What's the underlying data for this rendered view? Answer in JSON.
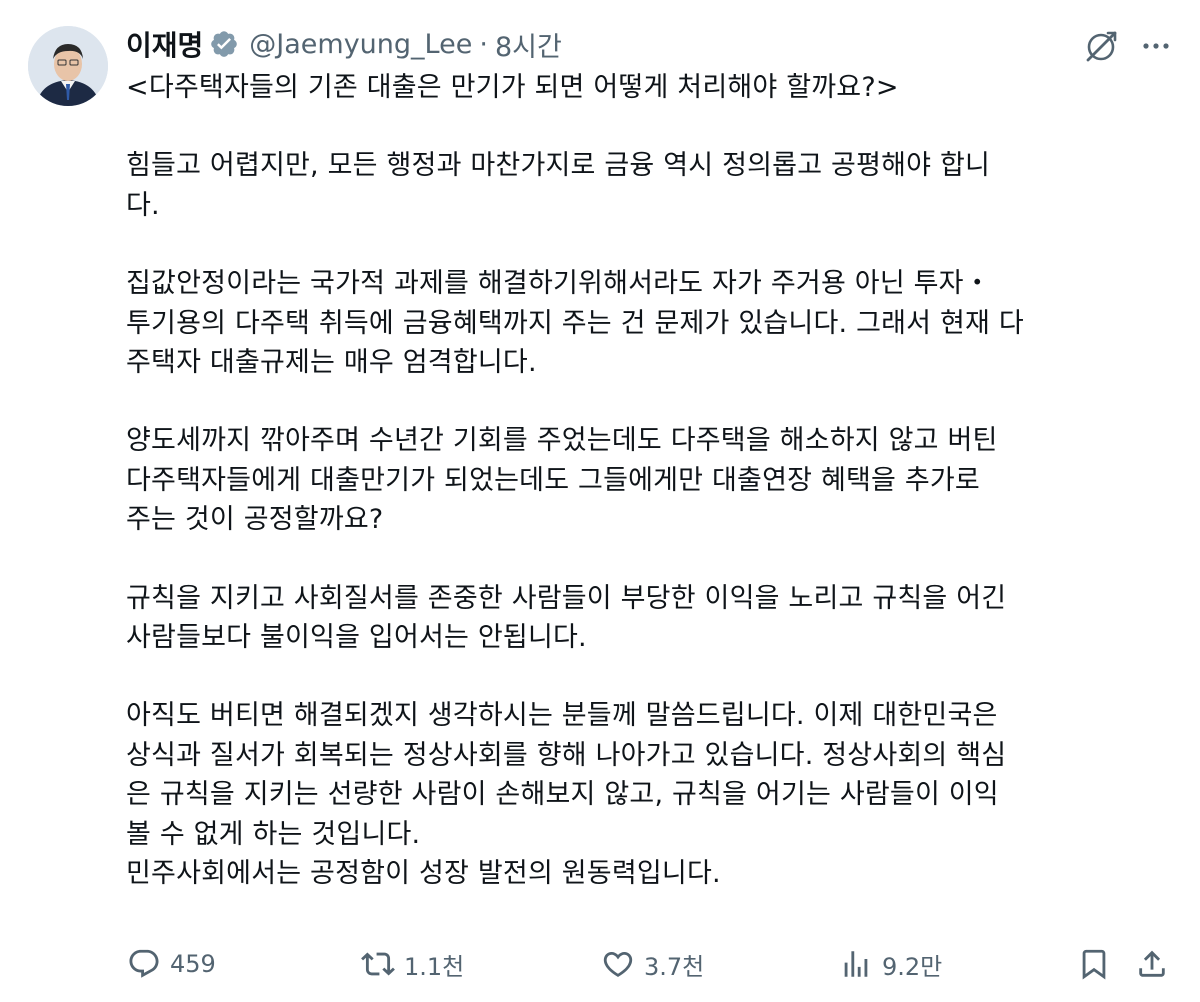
{
  "author": {
    "display_name": "이재명",
    "handle": "@Jaemyung_Lee",
    "separator": "·",
    "time": "8시간",
    "verified_color": "#829aab"
  },
  "tweet": {
    "paragraphs": [
      [
        "<다주택자들의 기존 대출은 만기가 되면 어떻게 처리해야 할까요?>"
      ],
      [
        "힘들고 어렵지만, 모든 행정과 마찬가지로 금융 역시 정의롭고 공평해야 합니",
        "다."
      ],
      [
        "집값안정이라는 국가적 과제를 해결하기위해서라도 자가 주거용 아닌 투자・",
        "투기용의 다주택 취득에 금융혜택까지 주는 건 문제가 있습니다. 그래서 현재 다",
        "주택자 대출규제는 매우 엄격합니다."
      ],
      [
        "양도세까지 깎아주며 수년간 기회를 주었는데도 다주택을 해소하지 않고 버틴",
        "다주택자들에게 대출만기가 되었는데도 그들에게만 대출연장 혜택을 추가로",
        "주는 것이 공정할까요?"
      ],
      [
        "규칙을 지키고 사회질서를 존중한 사람들이 부당한 이익을 노리고 규칙을 어긴",
        "사람들보다 불이익을 입어서는 안됩니다."
      ],
      [
        "아직도 버티면 해결되겠지 생각하시는 분들께 말씀드립니다. 이제 대한민국은",
        "상식과 질서가 회복되는 정상사회를 향해 나아가고 있습니다. 정상사회의 핵심",
        "은 규칙을 지키는 선량한 사람이 손해보지 않고, 규칙을 어기는 사람들이 이익",
        "볼 수 없게 하는 것입니다.",
        "민주사회에서는 공정함이 성장 발전의 원동력입니다."
      ]
    ]
  },
  "actions": {
    "reply_count": "459",
    "retweet_count": "1.1천",
    "like_count": "3.7천",
    "views_count": "9.2만"
  },
  "icons": {
    "verified": "verified-badge-icon",
    "grok": "grok-icon",
    "more": "more-icon",
    "reply": "reply-icon",
    "retweet": "retweet-icon",
    "like": "like-icon",
    "views": "views-icon",
    "bookmark": "bookmark-icon",
    "share": "share-icon"
  }
}
